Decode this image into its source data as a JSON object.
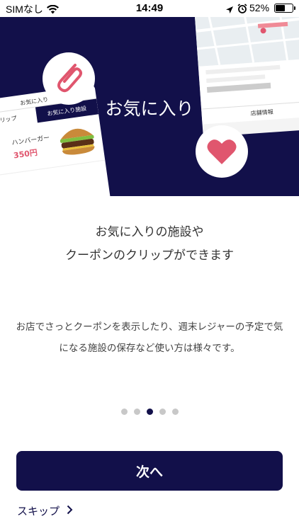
{
  "status_bar": {
    "carrier": "SIMなし",
    "time": "14:49",
    "battery_percent": "52%",
    "battery_level": 0.52,
    "icons": [
      "wifi-icon",
      "location-arrow-icon",
      "alarm-icon",
      "battery-icon"
    ]
  },
  "hero": {
    "title": "お気に入り",
    "background_color": "#12104a",
    "mock_left": {
      "header": "お気に入り",
      "tabs": [
        "クリップ",
        "お気に入り施設"
      ],
      "item_name": "ハンバーガー",
      "item_price": "350円"
    },
    "mock_right": {
      "tabs": [
        "店舗情報"
      ]
    },
    "icons": [
      "paperclip-icon",
      "heart-icon"
    ]
  },
  "content": {
    "subtitle_line1": "お気に入りの施設や",
    "subtitle_line2": "クーポンのクリップができます",
    "description": "お店でさっとクーポンを表示したり、週末レジャーの予定で気になる施設の保存など使い方は様々です。"
  },
  "pagination": {
    "total": 5,
    "current": 3
  },
  "actions": {
    "next_label": "次へ",
    "skip_label": "スキップ"
  },
  "colors": {
    "accent": "#12104a",
    "heart": "#e0566e",
    "clip": "#e0566e"
  }
}
